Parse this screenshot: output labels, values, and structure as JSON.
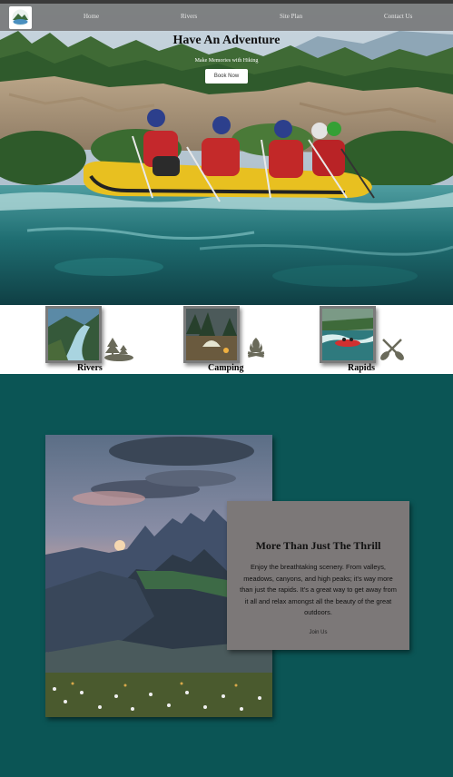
{
  "nav": {
    "items": [
      {
        "label": "Home"
      },
      {
        "label": "Rivers"
      },
      {
        "label": "Site Plan"
      },
      {
        "label": "Contact Us"
      }
    ]
  },
  "hero": {
    "title": "Have An Adventure",
    "subtitle": "Make Memories with Hiking",
    "button_label": "Book Now"
  },
  "features": [
    {
      "label": "Rivers",
      "icon": "trees-river-icon"
    },
    {
      "label": "Camping",
      "icon": "campfire-icon"
    },
    {
      "label": "Rapids",
      "icon": "crossed-paddles-icon"
    }
  ],
  "section": {
    "title": "More Than Just The Thrill",
    "body": "Enjoy the breathtaking scenery. From valleys, meadows, canyons, and high peaks; it's way more than just the rapids. It's a great way to get away from it all and relax amongst all the beauty of the great outdoors.",
    "link_label": "Join Us"
  },
  "colors": {
    "navbar": "#6e6e6e",
    "teal_background": "#0b5555",
    "card": "#7c7878",
    "raft": "#e8c020",
    "icon": "#6a6a5a"
  }
}
